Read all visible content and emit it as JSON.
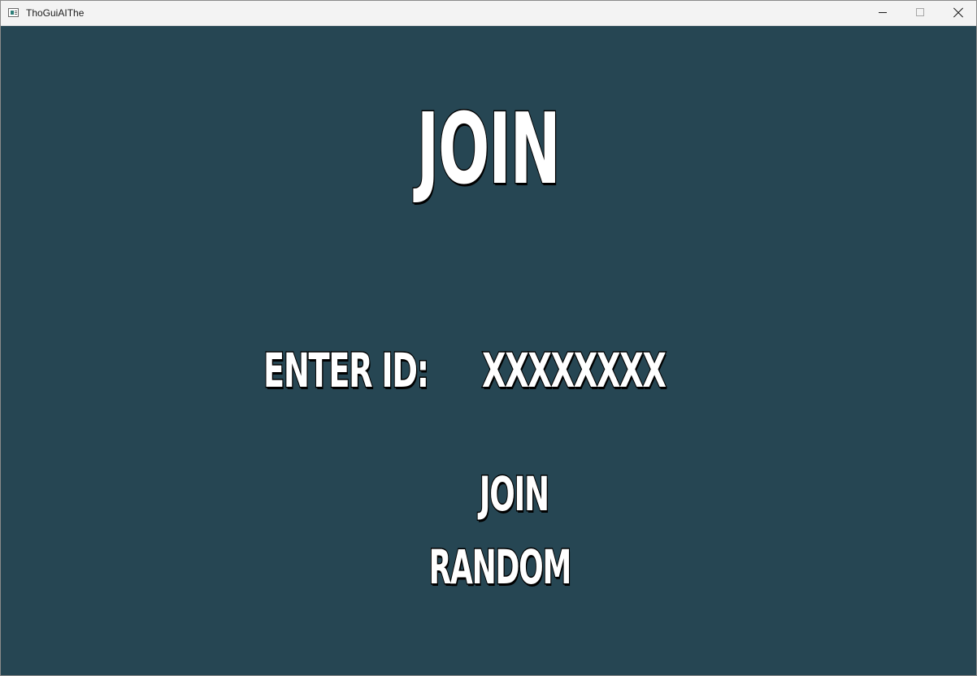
{
  "window": {
    "title": "ThoGuiAIThe",
    "app_icon": "app-window-icon",
    "controls": {
      "minimize_icon": "minimize-icon",
      "maximize_icon": "maximize-icon",
      "close_icon": "close-icon"
    }
  },
  "screen": {
    "heading": "JOIN",
    "id_label": "ENTER ID:",
    "id_value": "XXXXXXXX",
    "join_button": "JOIN",
    "random_button": "RANDOM"
  },
  "colors": {
    "background": "#264653",
    "text_fill": "#ffffff",
    "text_outline": "#000000"
  }
}
